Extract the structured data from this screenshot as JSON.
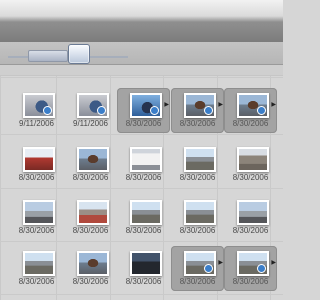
{
  "browser": {
    "zoom_level": 0.58,
    "photos": [
      {
        "date": "9/11/2006",
        "selected": false,
        "thumb": "tile",
        "badge": true
      },
      {
        "date": "9/11/2006",
        "selected": false,
        "thumb": "tile",
        "badge": true
      },
      {
        "date": "8/30/2006",
        "selected": true,
        "thumb": "blue",
        "badge": true
      },
      {
        "date": "8/30/2006",
        "selected": true,
        "thumb": "portrait",
        "badge": true
      },
      {
        "date": "8/30/2006",
        "selected": true,
        "thumb": "portrait",
        "badge": true
      },
      {
        "date": "8/30/2006",
        "selected": false,
        "thumb": "red",
        "badge": false
      },
      {
        "date": "8/30/2006",
        "selected": false,
        "thumb": "portrait",
        "badge": false
      },
      {
        "date": "8/30/2006",
        "selected": false,
        "thumb": "sign",
        "badge": false
      },
      {
        "date": "8/30/2006",
        "selected": false,
        "thumb": "mountain",
        "badge": false
      },
      {
        "date": "8/30/2006",
        "selected": false,
        "thumb": "rocky",
        "badge": false
      },
      {
        "date": "8/30/2006",
        "selected": false,
        "thumb": "road",
        "badge": false
      },
      {
        "date": "8/30/2006",
        "selected": false,
        "thumb": "redsoil",
        "badge": false
      },
      {
        "date": "8/30/2006",
        "selected": false,
        "thumb": "mountain",
        "badge": false
      },
      {
        "date": "8/30/2006",
        "selected": false,
        "thumb": "mountain",
        "badge": false
      },
      {
        "date": "8/30/2006",
        "selected": false,
        "thumb": "road",
        "badge": false
      },
      {
        "date": "8/30/2006",
        "selected": false,
        "thumb": "mountain",
        "badge": false
      },
      {
        "date": "8/30/2006",
        "selected": false,
        "thumb": "portrait",
        "badge": false
      },
      {
        "date": "8/30/2006",
        "selected": false,
        "thumb": "night",
        "badge": false
      },
      {
        "date": "8/30/2006",
        "selected": true,
        "thumb": "mountain",
        "badge": true
      },
      {
        "date": "8/30/2006",
        "selected": true,
        "thumb": "mountain",
        "badge": true
      }
    ]
  }
}
